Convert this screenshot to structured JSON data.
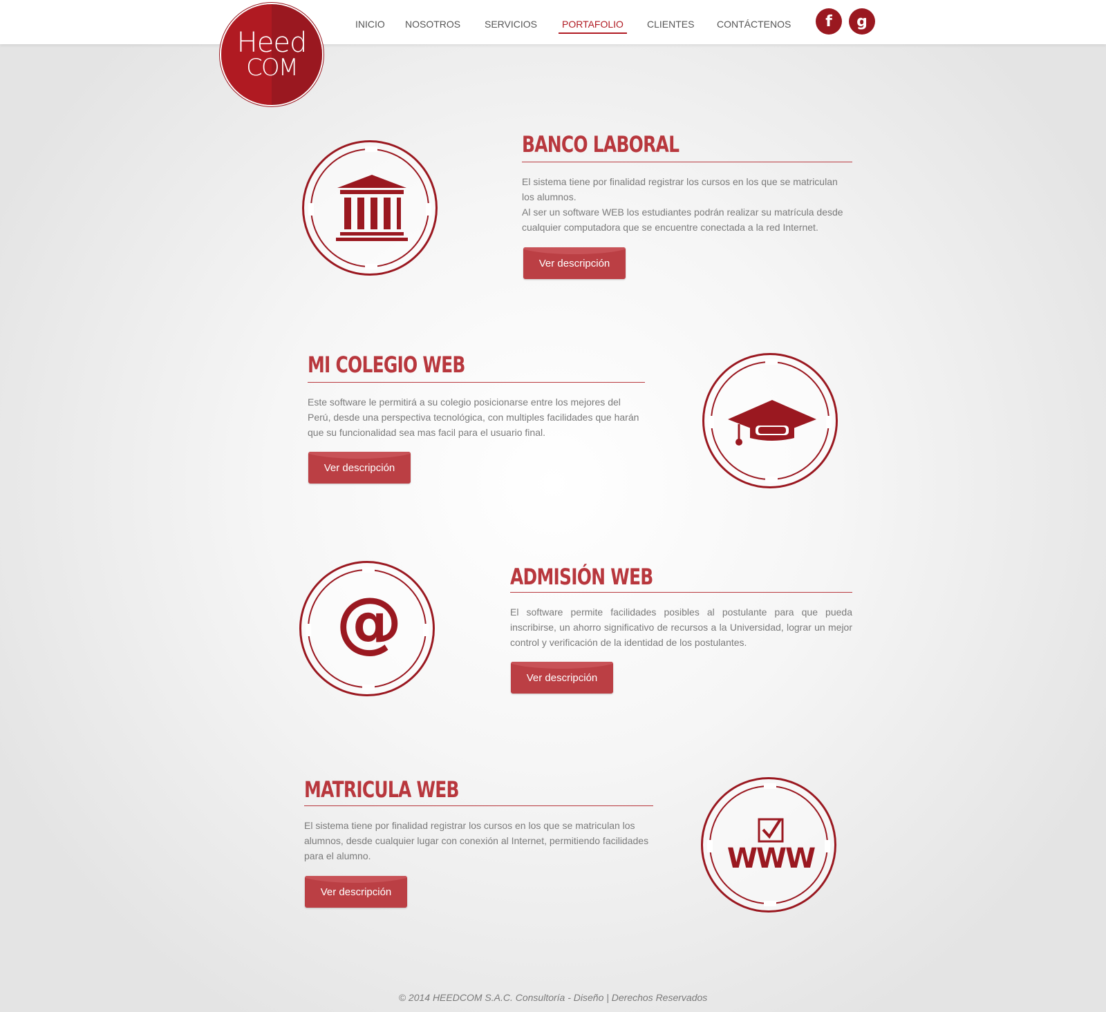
{
  "brand": {
    "logo_line1": "Heed",
    "logo_line2": "COM"
  },
  "nav": {
    "items": [
      {
        "label": "INICIO"
      },
      {
        "label": "NOSOTROS"
      },
      {
        "label": "SERVICIOS"
      },
      {
        "label": "PORTAFOLIO"
      },
      {
        "label": "CLIENTES"
      },
      {
        "label": "CONTÁCTENOS"
      }
    ],
    "active": "PORTAFOLIO"
  },
  "social": {
    "facebook": "f",
    "google": "g"
  },
  "sections": [
    {
      "title": "BANCO LABORAL",
      "icon": "bank-icon",
      "paragraphs": [
        "El sistema tiene por finalidad registrar los cursos en los que se matriculan los alumnos.",
        "Al ser un software WEB los estudiantes podrán realizar su matrícula desde cualquier computadora que se encuentre conectada a la red Internet."
      ],
      "button": "Ver descripción"
    },
    {
      "title": "MI COLEGIO WEB",
      "icon": "graduation-cap-icon",
      "paragraphs": [
        "Este software le permitirá a su colegio posicionarse entre los mejores del Perú, desde una perspectiva tecnológica, con multiples facilidades que harán que su funcionalidad sea mas facil para el usuario final."
      ],
      "button": "Ver descripción"
    },
    {
      "title": "ADMISIÓN WEB",
      "icon": "at-sign-icon",
      "icon_text": "@",
      "paragraphs": [
        "El software permite facilidades posibles al postulante para que pueda inscribirse, un ahorro significativo de recursos a la Universidad,  lograr un mejor control y verificación de la identidad de los postulantes."
      ],
      "button": "Ver descripción"
    },
    {
      "title": "MATRICULA WEB",
      "icon": "www-checkbox-icon",
      "icon_text": "WWW",
      "paragraphs": [
        "El sistema tiene por finalidad registrar los cursos en los que se matriculan los alumnos, desde cualquier lugar con conexión al Internet, permitiendo facilidades para el alumno."
      ],
      "button": "Ver descripción"
    }
  ],
  "footer": {
    "text": "© 2014 HEEDCOM S.A.C. Consultoría - Diseño | Derechos Reservados"
  },
  "colors": {
    "brand_red": "#9a1820",
    "title_red": "#b8373d",
    "button_red": "#bb3f44",
    "text_gray": "#7a7a7a"
  }
}
